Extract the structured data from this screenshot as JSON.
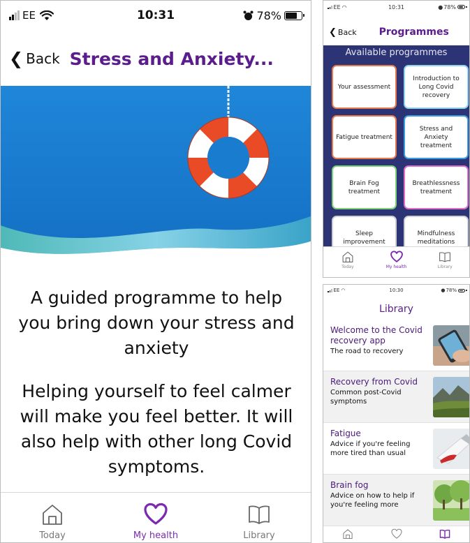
{
  "main": {
    "status": {
      "carrier": "EE",
      "time": "10:31",
      "battery": "78%",
      "battery_level": 0.78
    },
    "back_label": "Back",
    "title": "Stress and Anxiety...",
    "heading": "A guided programme to help you bring down your stress and anxiety",
    "body": "Helping yourself to feel calmer will make you feel better. It will also help with other long Covid symptoms.",
    "tabs": [
      {
        "label": "Today",
        "icon": "home-icon",
        "active": false
      },
      {
        "label": "My health",
        "icon": "heart-icon",
        "active": true
      },
      {
        "label": "Library",
        "icon": "book-icon",
        "active": false
      }
    ]
  },
  "programmes": {
    "status": {
      "carrier": "EE",
      "time": "10:31",
      "battery": "78%"
    },
    "back_label": "Back",
    "title": "Programmes",
    "panel_heading": "Available programmes",
    "cards": [
      {
        "label": "Your assessment",
        "color": "#e8794a"
      },
      {
        "label": "Introduction to Long Covid recovery",
        "color": "#8fd3f0"
      },
      {
        "label": "Fatigue treatment",
        "color": "#e8794a"
      },
      {
        "label": "Stress and Anxiety treatment",
        "color": "#3a9de0"
      },
      {
        "label": "Brain Fog treatment",
        "color": "#7ed37a"
      },
      {
        "label": "Breathlessness treatment",
        "color": "#e06fc8"
      },
      {
        "label": "Sleep improvement",
        "color": "#cfcfcf"
      },
      {
        "label": "Mindfulness meditations",
        "color": "#cfcfcf"
      }
    ],
    "tabs": [
      {
        "label": "Today",
        "icon": "home-icon",
        "active": false
      },
      {
        "label": "My health",
        "icon": "heart-icon",
        "active": true
      },
      {
        "label": "Library",
        "icon": "book-icon",
        "active": false
      }
    ]
  },
  "library": {
    "status": {
      "carrier": "EE",
      "time": "10:30",
      "battery": "78%"
    },
    "title": "Library",
    "items": [
      {
        "title": "Welcome to the Covid recovery app",
        "subtitle": "The road to recovery",
        "thumb": "phone-hand"
      },
      {
        "title": "Recovery from Covid",
        "subtitle": "Common post-Covid symptoms",
        "thumb": "landscape"
      },
      {
        "title": "Fatigue",
        "subtitle": "Advice if you're feeling more tired than usual",
        "thumb": "toothpaste"
      },
      {
        "title": "Brain fog",
        "subtitle": "Advice on how to help if you're feeling more",
        "thumb": "trees"
      }
    ],
    "tabs": [
      {
        "icon": "home-icon",
        "active": false
      },
      {
        "icon": "heart-icon",
        "active": false
      },
      {
        "icon": "book-icon",
        "active": true
      }
    ]
  },
  "colors": {
    "brand_purple": "#5b1d8c",
    "active_tab": "#7b2bb0",
    "panel_navy": "#2c3476",
    "hero_blue": "#1d7fd1"
  }
}
